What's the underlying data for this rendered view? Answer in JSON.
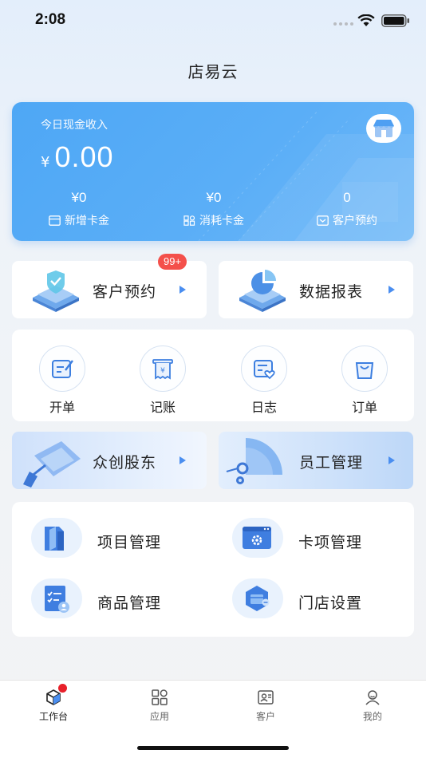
{
  "status_bar": {
    "time": "2:08"
  },
  "app": {
    "title": "店易云"
  },
  "revenue_card": {
    "label": "今日现金收入",
    "currency": "¥",
    "amount": "0.00",
    "stats": [
      {
        "value": "¥0",
        "label": "新增卡金",
        "icon": "card-icon"
      },
      {
        "value": "¥0",
        "label": "消耗卡金",
        "icon": "grid-icon"
      },
      {
        "value": "0",
        "label": "客户预约",
        "icon": "calendar-icon"
      }
    ]
  },
  "features": {
    "appointment": {
      "label": "客户预约",
      "badge": "99+"
    },
    "reports": {
      "label": "数据报表"
    }
  },
  "quick_actions": [
    {
      "label": "开单",
      "icon": "edit-icon"
    },
    {
      "label": "记账",
      "icon": "receipt-icon"
    },
    {
      "label": "日志",
      "icon": "log-icon"
    },
    {
      "label": "订单",
      "icon": "bag-icon"
    }
  ],
  "banners": {
    "shareholders": {
      "label": "众创股东"
    },
    "staff": {
      "label": "员工管理"
    }
  },
  "management": [
    {
      "label": "项目管理",
      "icon": "folder-icon"
    },
    {
      "label": "卡项管理",
      "icon": "card-settings-icon"
    },
    {
      "label": "商品管理",
      "icon": "clipboard-icon"
    },
    {
      "label": "门店设置",
      "icon": "store-settings-icon"
    }
  ],
  "tab_bar": [
    {
      "label": "工作台",
      "icon": "cube-icon",
      "active": true
    },
    {
      "label": "应用",
      "icon": "apps-icon",
      "active": false
    },
    {
      "label": "客户",
      "icon": "contact-icon",
      "active": false
    },
    {
      "label": "我的",
      "icon": "user-icon",
      "active": false
    }
  ],
  "colors": {
    "accent": "#4ea7f5",
    "badge": "#f4504b",
    "arrow": "#4a8ef0",
    "dot": "#e8202a"
  }
}
